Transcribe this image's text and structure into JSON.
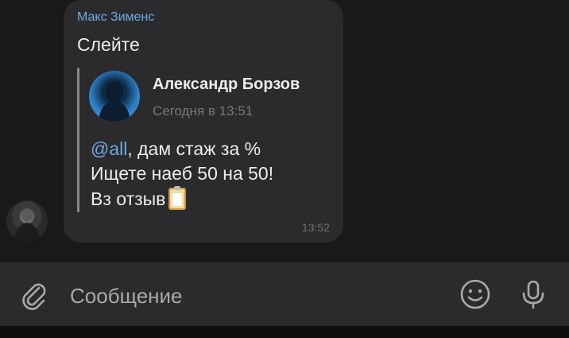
{
  "message": {
    "sender_name": "Макс Зименс",
    "text": "Слейте",
    "time": "13:52",
    "quote": {
      "author": "Александр Борзов",
      "time": "Сегодня в 13:51",
      "mention": "@all",
      "line1_rest": ", дам стаж за %",
      "line2": "Ищете наеб 50 на 50!",
      "line3": "Вз отзыв",
      "emoji": "clipboard-icon"
    }
  },
  "composer": {
    "placeholder": "Сообщение",
    "icons": [
      "attach-icon",
      "emoji-icon",
      "microphone-icon"
    ]
  },
  "colors": {
    "background": "#19191a",
    "bubble": "#2b2b2d",
    "accent": "#6ea8e6"
  }
}
